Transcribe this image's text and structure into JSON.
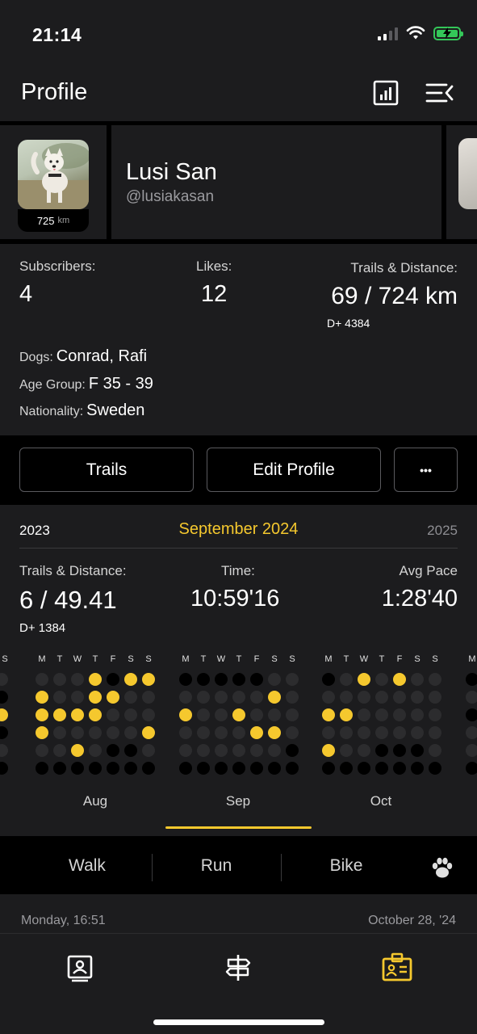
{
  "status_bar": {
    "time": "21:14"
  },
  "header": {
    "title": "Profile",
    "stats_icon": "bar-chart-icon",
    "menu_icon": "collapse-menu-icon"
  },
  "profile": {
    "avatar_km_value": "725",
    "avatar_km_unit": "km",
    "name": "Lusi San",
    "handle": "@lusiakasan"
  },
  "stats": {
    "subscribers_label": "Subscribers:",
    "subscribers_value": "4",
    "likes_label": "Likes:",
    "likes_value": "12",
    "trails_label": "Trails & Distance:",
    "trails_value": "69 / 724 km",
    "elevation": "D+ 4384",
    "dogs_label": "Dogs:",
    "dogs_value": "Conrad, Rafi",
    "age_label": "Age Group:",
    "age_value": "F 35 - 39",
    "nationality_label": "Nationality:",
    "nationality_value": "Sweden"
  },
  "buttons": {
    "trails": "Trails",
    "edit_profile": "Edit Profile",
    "more": "•••"
  },
  "calendar": {
    "prev_year": "2023",
    "current": "September 2024",
    "next_year": "2025",
    "trails_label": "Trails & Distance:",
    "trails_value": "6 / 49.41",
    "elevation": "D+ 1384",
    "time_label": "Time:",
    "time_value": "10:59'16",
    "pace_label": "Avg Pace",
    "pace_value": "1:28'40",
    "weekday_letters": [
      "M",
      "T",
      "W",
      "T",
      "F",
      "S",
      "S"
    ],
    "months": [
      "Aug",
      "Sep",
      "Oct"
    ],
    "accent": "#f5c82e"
  },
  "activity_tabs": {
    "walk": "Walk",
    "run": "Run",
    "bike": "Bike",
    "paw_icon": "paw-icon"
  },
  "feed": {
    "left": "Monday, 16:51",
    "right": "October 28, '24"
  },
  "tabbar": {
    "feed_icon": "contact-card-icon",
    "trails_icon": "signpost-icon",
    "profile_icon": "id-badge-icon"
  }
}
